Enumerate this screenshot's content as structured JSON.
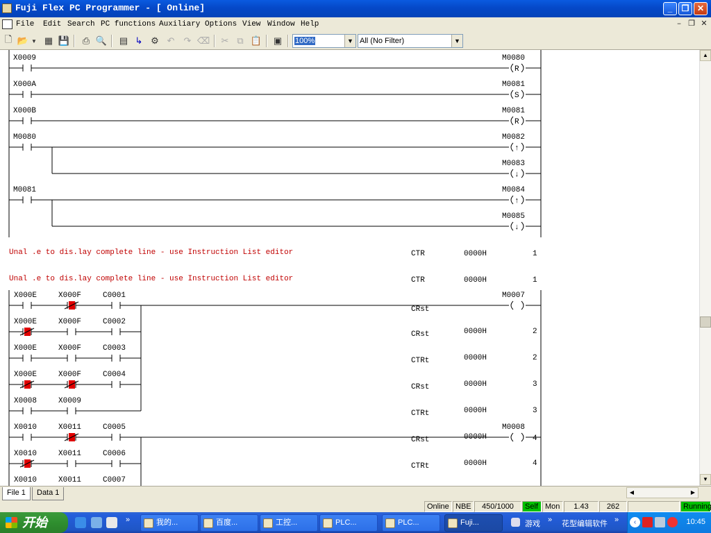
{
  "window": {
    "title": "Fuji Flex PC Programmer - [ Online]"
  },
  "menu": [
    {
      "label": "File"
    },
    {
      "label": "Edit"
    },
    {
      "label": "Search"
    },
    {
      "label": "PC functions"
    },
    {
      "label": "Auxiliary"
    },
    {
      "label": "Options"
    },
    {
      "label": "View"
    },
    {
      "label": "Window"
    },
    {
      "label": "Help"
    }
  ],
  "toolbar": {
    "icons": [
      "new-file-icon",
      "open-folder-icon",
      "dropdown-arrow-icon",
      "print-setup-icon",
      "save-icon",
      "print-icon",
      "print-preview-icon",
      "monitor-icon",
      "step-icon",
      "compile-icon",
      "undo-icon",
      "redo-icon",
      "clear-icon",
      "cut-icon",
      "copy-icon",
      "paste-icon",
      "pc-status-icon"
    ],
    "zoom": "100%",
    "filter": "All (No Filter)"
  },
  "ladder": {
    "rungs": [
      {
        "contact": "X0009",
        "coil": "M0080",
        "coil_symbol": "R"
      },
      {
        "contact": "X000A",
        "coil": "M0081",
        "coil_symbol": "S"
      },
      {
        "contact": "X000B",
        "coil": "M0081",
        "coil_symbol": "R"
      },
      {
        "contact": "M0080",
        "coil": "M0082",
        "coil_symbol": "↑",
        "branch_coil": "M0083",
        "branch_symbol": "↓"
      },
      {
        "contact": "M0081",
        "coil": "M0084",
        "coil_symbol": "↑",
        "branch_coil": "M0085",
        "branch_symbol": "↓"
      }
    ],
    "error_lines": [
      {
        "message": "Unal .e to dis.lay complete line - use Instruction List editor",
        "instr": "CTR",
        "value": "0000H",
        "num": "1"
      },
      {
        "message": "Unal .e to dis.lay complete line - use Instruction List editor",
        "instr": "CTR",
        "value": "0000H",
        "num": "1"
      }
    ],
    "counter_rows": [
      {
        "contacts": [
          "X000E",
          "X000F",
          "C0001"
        ],
        "instr": "CRst",
        "value": "",
        "num": "",
        "coil": "M0007"
      },
      {
        "contacts": [
          "X000E",
          "X000F",
          "C0002"
        ],
        "instr": "CRst",
        "value": "0000H",
        "num": "2"
      },
      {
        "contacts": [
          "X000E",
          "X000F",
          "C0003"
        ],
        "instr": "CTRt",
        "value": "0000H",
        "num": "2"
      },
      {
        "contacts": [
          "X000E",
          "X000F",
          "C0004"
        ],
        "instr": "CRst",
        "value": "0000H",
        "num": "3"
      },
      {
        "contacts": [
          "X0008",
          "X0009",
          ""
        ],
        "instr": "CTRt",
        "value": "0000H",
        "num": "3"
      },
      {
        "contacts": [
          "X0010",
          "X0011",
          "C0005"
        ],
        "instr": "CRst",
        "value": "0000H",
        "num": "4",
        "coil": "M0008"
      },
      {
        "contacts": [
          "X0010",
          "X0011",
          "C0006"
        ],
        "instr": "CTRt",
        "value": "0000H",
        "num": "4"
      },
      {
        "contacts": [
          "X0010",
          "X0011",
          "C0007"
        ],
        "instr": "",
        "value": "",
        "num": ""
      }
    ]
  },
  "tabs": [
    "File 1",
    "Data 1"
  ],
  "status": {
    "mode": "Online",
    "nbe": "NBE",
    "steps": "450/1000",
    "self": "Self",
    "mon": "Mon",
    "scan": "1.43",
    "count": "262",
    "running": "Running",
    "self_color": "#00c000",
    "running_color": "#00c000"
  },
  "taskbar": {
    "start": "开始",
    "tasks": [
      {
        "label": "我的..."
      },
      {
        "label": "百度..."
      },
      {
        "label": "工控..."
      },
      {
        "label": "PLC..."
      },
      {
        "label": "PLC..."
      },
      {
        "label": "Fuji..."
      }
    ],
    "extra": [
      "游戏",
      "花型编辑软件"
    ],
    "chevron": "»",
    "clock": "10:45"
  }
}
